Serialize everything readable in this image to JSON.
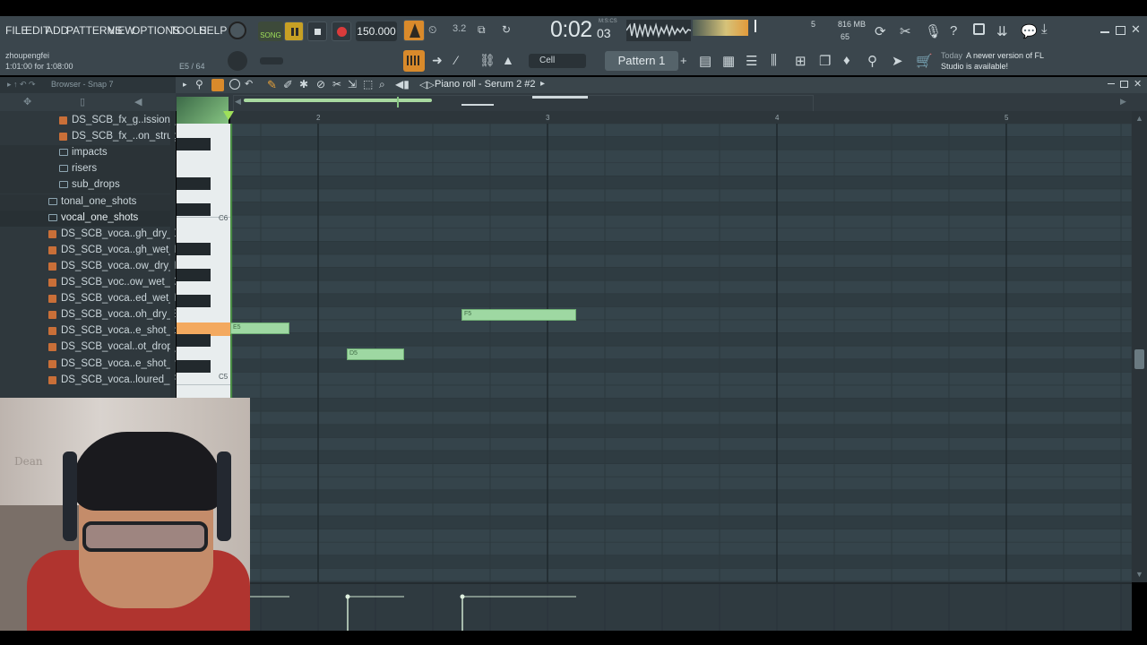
{
  "menu": [
    "FILE",
    "EDIT",
    "ADD",
    "PATTERNS",
    "VIEW",
    "OPTIONS",
    "TOOLS",
    "HELP"
  ],
  "transport": {
    "mode": "SONG",
    "tempo": "150.000",
    "time": "0:02",
    "time_small": "03",
    "time_unit": "M:S:CS",
    "cpu_voices": "5",
    "memory": "816 MB",
    "cpu_number": "65"
  },
  "hint": {
    "user": "zhoupengfei",
    "position": "1:01:00 for 1:08:00",
    "note": "E5 / 64"
  },
  "snap": {
    "value": "Cell"
  },
  "pattern": {
    "name": "Pattern 1"
  },
  "news": {
    "date": "Today",
    "message_1": "A newer version of FL",
    "message_2": "Studio is available!"
  },
  "browser": {
    "title": "Browser - Snap 7",
    "items": [
      {
        "label": "DS_SCB_fx_g..ission_step",
        "kind": "audio"
      },
      {
        "label": "DS_SCB_fx_..on_struggle",
        "kind": "audio"
      },
      {
        "label": "impacts",
        "kind": "folder"
      },
      {
        "label": "risers",
        "kind": "folder"
      },
      {
        "label": "sub_drops",
        "kind": "folder"
      },
      {
        "label": "tonal_one_shots",
        "kind": "folder"
      },
      {
        "label": "vocal_one_shots",
        "kind": "folder"
      },
      {
        "label": "DS_SCB_voca..gh_dry_Dmin",
        "kind": "audio"
      },
      {
        "label": "DS_SCB_voca..gh_wet_Dmin",
        "kind": "audio"
      },
      {
        "label": "DS_SCB_voca..ow_dry_Dmin",
        "kind": "audio"
      },
      {
        "label": "DS_SCB_voc..ow_wet_Dmin",
        "kind": "audio"
      },
      {
        "label": "DS_SCB_voca..ed_wet_Emin",
        "kind": "audio"
      },
      {
        "label": "DS_SCB_voca..oh_dry_Emin",
        "kind": "audio"
      },
      {
        "label": "DS_SCB_voca..e_shot_check",
        "kind": "audio"
      },
      {
        "label": "DS_SCB_vocal..ot_drop_the",
        "kind": "audio"
      },
      {
        "label": "DS_SCB_voca..e_shot_remix",
        "kind": "audio"
      },
      {
        "label": "DS_SCB_voca..loured_Fmin",
        "kind": "audio"
      }
    ]
  },
  "piano_roll": {
    "title": "Piano roll - Serum 2 #2",
    "ruler": [
      "2",
      "3",
      "4",
      "5"
    ],
    "key_labels": [
      "C6",
      "C5"
    ],
    "notes": [
      {
        "label": "E5",
        "start_bar": 1.0,
        "end_bar": 1.875
      },
      {
        "label": "D5",
        "start_bar": 2.125,
        "end_bar": 2.375
      },
      {
        "label": "F5",
        "start_bar": 2.625,
        "end_bar": 3.125
      }
    ],
    "playhead_bar": 1.61
  },
  "webcam": {
    "wall_text": "Dean"
  }
}
